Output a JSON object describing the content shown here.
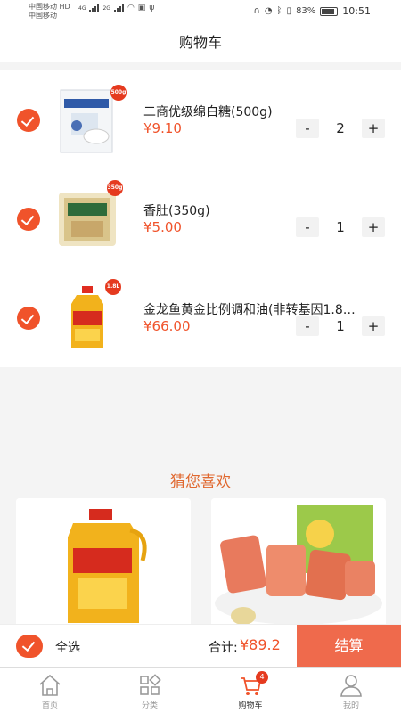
{
  "status_bar": {
    "carrier1": "中国移动 HD",
    "carrier2": "中国移动",
    "net1": "4G",
    "net2": "2G",
    "battery": "83%",
    "time": "10:51"
  },
  "header": {
    "title": "购物车"
  },
  "cart": {
    "items": [
      {
        "name": "二商优级绵白糖(500g)",
        "price": "¥9.10",
        "quantity": "2",
        "tag": "500g",
        "icon": "sugar-bag-image"
      },
      {
        "name": "香肚(350g)",
        "price": "¥5.00",
        "quantity": "1",
        "tag": "350g",
        "icon": "sausage-pack-image"
      },
      {
        "name": "金龙鱼黄金比例调和油(非转基因1.8…",
        "price": "¥66.00",
        "quantity": "1",
        "tag": "1.8L",
        "icon": "oil-bottle-image"
      }
    ],
    "minus_label": "-",
    "plus_label": "+"
  },
  "recommend": {
    "title": "猜您喜欢"
  },
  "checkout": {
    "select_all": "全选",
    "total_label": "合计:",
    "total_value": "¥89.2",
    "button": "结算"
  },
  "tabs": [
    {
      "label": "首页",
      "icon": "home-icon"
    },
    {
      "label": "分类",
      "icon": "category-icon"
    },
    {
      "label": "购物车",
      "icon": "cart-icon",
      "badge": "4"
    },
    {
      "label": "我的",
      "icon": "profile-icon"
    }
  ],
  "colors": {
    "accent": "#f0532b",
    "checkout": "#ef6a4c",
    "recommend_title": "#e0682f"
  }
}
